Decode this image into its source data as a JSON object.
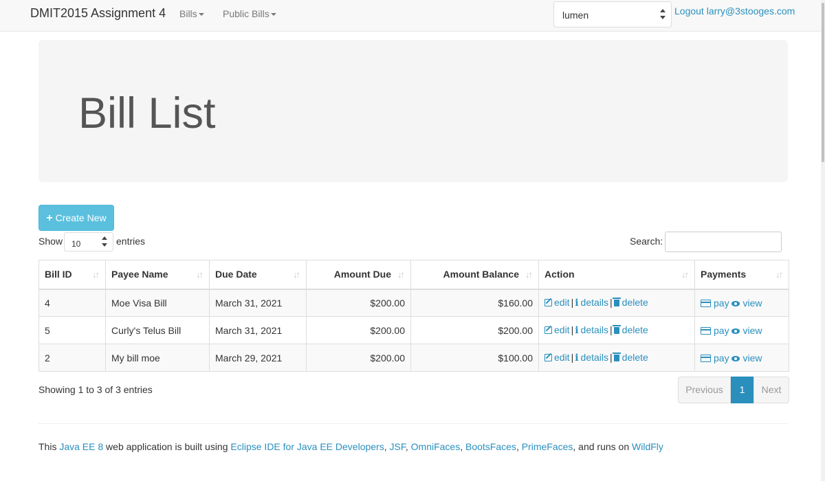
{
  "navbar": {
    "brand": "DMIT2015 Assignment 4",
    "menus": [
      {
        "label": "Bills"
      },
      {
        "label": "Public Bills"
      }
    ],
    "theme_select": {
      "value": "lumen"
    },
    "logout": "Logout larry@3stooges.com"
  },
  "jumbotron": {
    "title": "Bill List"
  },
  "controls": {
    "create_label": "Create New",
    "show_label": "Show",
    "length_value": "10",
    "entries_label": "entries",
    "search_label": "Search:",
    "search_value": ""
  },
  "table": {
    "columns": [
      "Bill ID",
      "Payee Name",
      "Due Date",
      "Amount Due",
      "Amount Balance",
      "Action",
      "Payments"
    ],
    "rows": [
      {
        "id": "4",
        "payee": "Moe Visa Bill",
        "due": "March 31, 2021",
        "amount_due": "$200.00",
        "balance": "$160.00"
      },
      {
        "id": "5",
        "payee": "Curly's Telus Bill",
        "due": "March 31, 2021",
        "amount_due": "$200.00",
        "balance": "$200.00"
      },
      {
        "id": "2",
        "payee": "My bill moe",
        "due": "March 29, 2021",
        "amount_due": "$200.00",
        "balance": "$100.00"
      }
    ],
    "action_labels": {
      "edit": "edit",
      "details": "details",
      "delete": "delete"
    },
    "payment_labels": {
      "pay": "pay",
      "view": "view"
    }
  },
  "summary": "Showing 1 to 3 of 3 entries",
  "pagination": {
    "previous": "Previous",
    "current": "1",
    "next": "Next"
  },
  "footer": {
    "t1": "This ",
    "l1": "Java EE 8",
    "t2": " web application is built using ",
    "l2": "Eclipse IDE for Java EE Developers",
    "t3": ", ",
    "l3": "JSF",
    "t4": ", ",
    "l4": "OmniFaces",
    "t5": ", ",
    "l5": "BootsFaces",
    "t6": ", ",
    "l6": "PrimeFaces",
    "t7": ", and runs on ",
    "l7": "WildFly"
  },
  "colors": {
    "link": "#2a8fbd",
    "create_button": "#5bc0de",
    "active_page": "#2a8fbd"
  },
  "icons": {
    "edit": "edit-icon",
    "details": "info-icon",
    "delete": "trash-icon",
    "pay": "credit-card-icon",
    "view": "eye-icon",
    "sort": "sort-icon",
    "create": "plus-icon"
  }
}
